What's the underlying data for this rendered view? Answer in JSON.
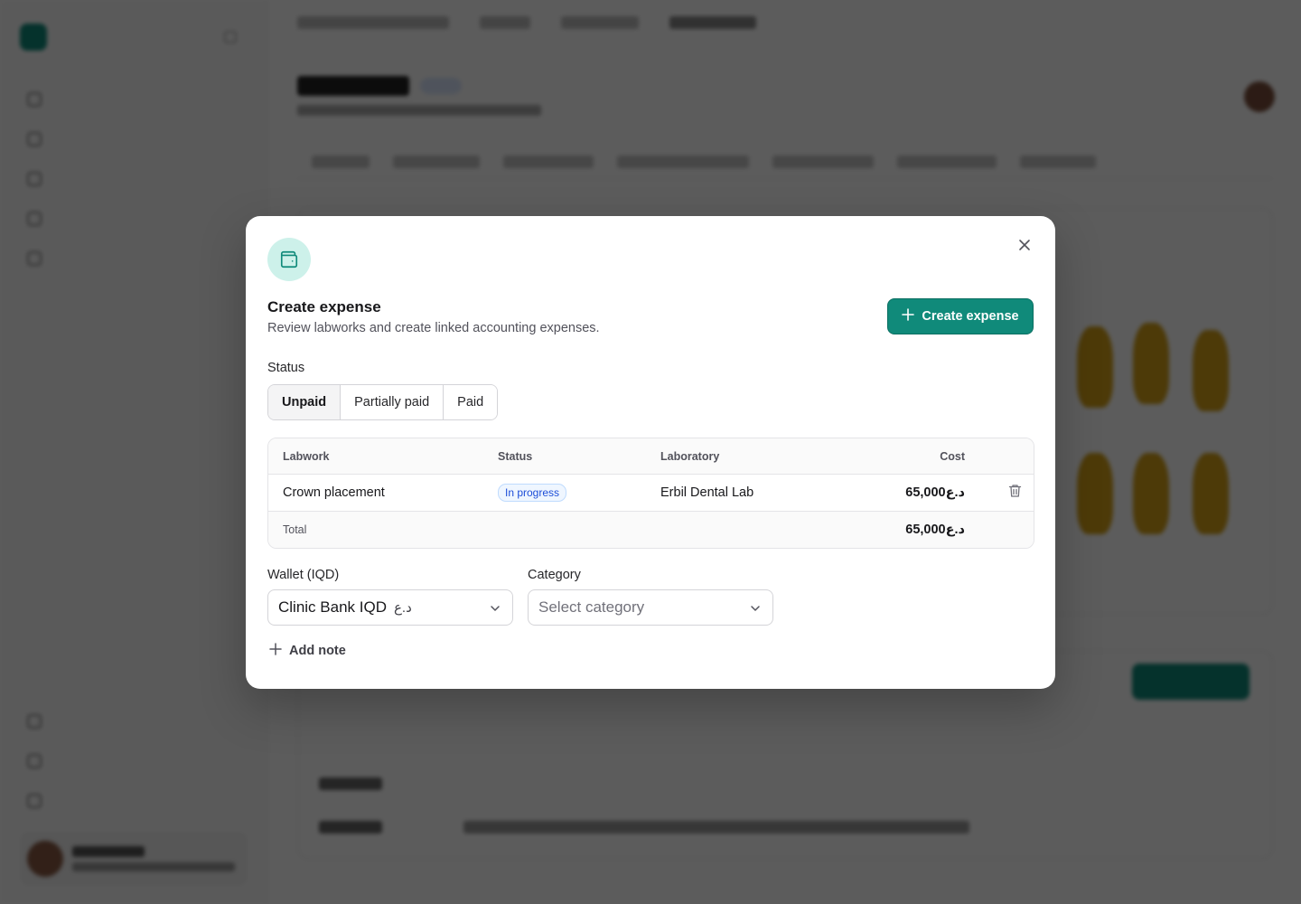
{
  "dialog": {
    "title": "Create expense",
    "description": "Review labworks and create linked accounting expenses.",
    "create_button_label": "Create expense",
    "status_label": "Status",
    "status_options": [
      "Unpaid",
      "Partially paid",
      "Paid"
    ],
    "status_selected": "Unpaid",
    "table": {
      "headers": {
        "labwork": "Labwork",
        "status": "Status",
        "laboratory": "Laboratory",
        "cost": "Cost"
      },
      "rows": [
        {
          "labwork": "Crown placement",
          "status": "In progress",
          "laboratory": "Erbil Dental Lab",
          "cost": "د.ع65,000"
        }
      ],
      "total_label": "Total",
      "total_value": "د.ع65,000"
    },
    "wallet": {
      "label": "Wallet (IQD)",
      "value": "Clinic Bank IQD",
      "currency_symbol": "د.ع"
    },
    "category": {
      "label": "Category",
      "placeholder": "Select category"
    },
    "add_note_label": "Add note"
  },
  "colors": {
    "primary": "#108a7a",
    "icon_bg": "#cdf1ea",
    "status_pill_text": "#1d4ed8",
    "status_pill_bg": "#eff6ff"
  }
}
